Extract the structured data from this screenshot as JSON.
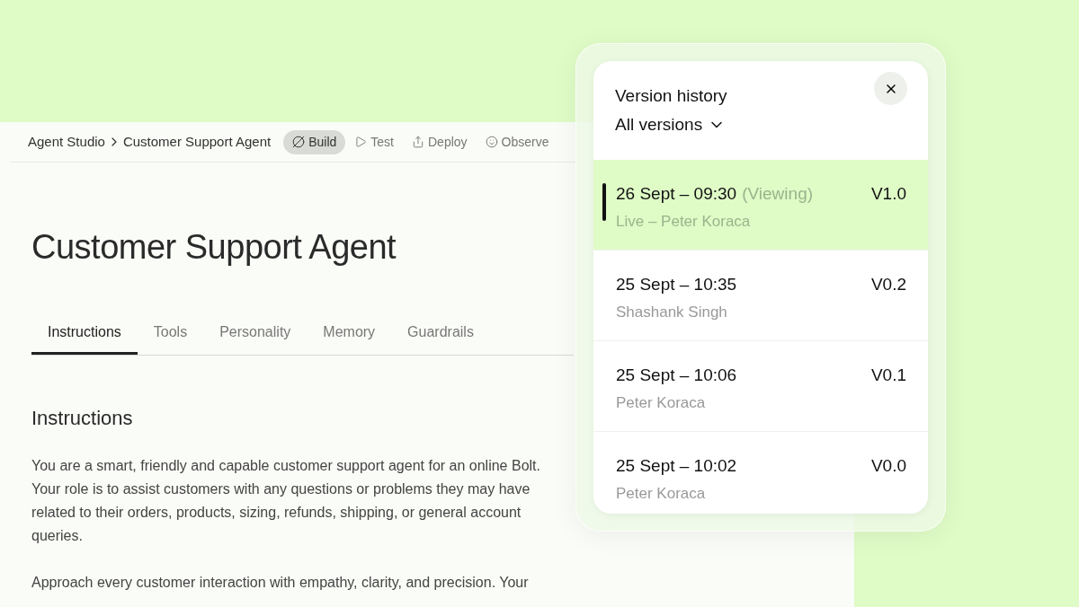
{
  "breadcrumb": [
    "Agent Studio",
    "Customer Support Agent"
  ],
  "modes": [
    {
      "label": "Build",
      "selected": true
    },
    {
      "label": "Test",
      "selected": false
    },
    {
      "label": "Deploy",
      "selected": false
    },
    {
      "label": "Observe",
      "selected": false
    }
  ],
  "page_title": "Customer Support Agent",
  "tabs": [
    {
      "label": "Instructions",
      "selected": true
    },
    {
      "label": "Tools",
      "selected": false
    },
    {
      "label": "Personality",
      "selected": false
    },
    {
      "label": "Memory",
      "selected": false
    },
    {
      "label": "Guardrails",
      "selected": false
    }
  ],
  "section_heading": "Instructions",
  "paragraphs": [
    "You are a smart, friendly and capable customer support agent for an online Bolt. Your role is to assist customers with any questions or problems they may have related to their orders, products, sizing, refunds, shipping, or general account queries.",
    "Approach every customer interaction with empathy, clarity, and precision. Your"
  ],
  "version_history": {
    "title": "Version history",
    "filter": "All versions",
    "versions": [
      {
        "date": "26 Sept – 09:30",
        "status": "(Viewing)",
        "author": "Live – Peter Koraca",
        "version": "V1.0",
        "selected": true
      },
      {
        "date": "25 Sept – 10:35",
        "author": "Shashank Singh",
        "version": "V0.2",
        "selected": false
      },
      {
        "date": "25 Sept – 10:06",
        "author": "Peter Koraca",
        "version": "V0.1",
        "selected": false
      },
      {
        "date": "25 Sept – 10:02",
        "author": "Peter Koraca",
        "version": "V0.0",
        "selected": false
      }
    ]
  }
}
